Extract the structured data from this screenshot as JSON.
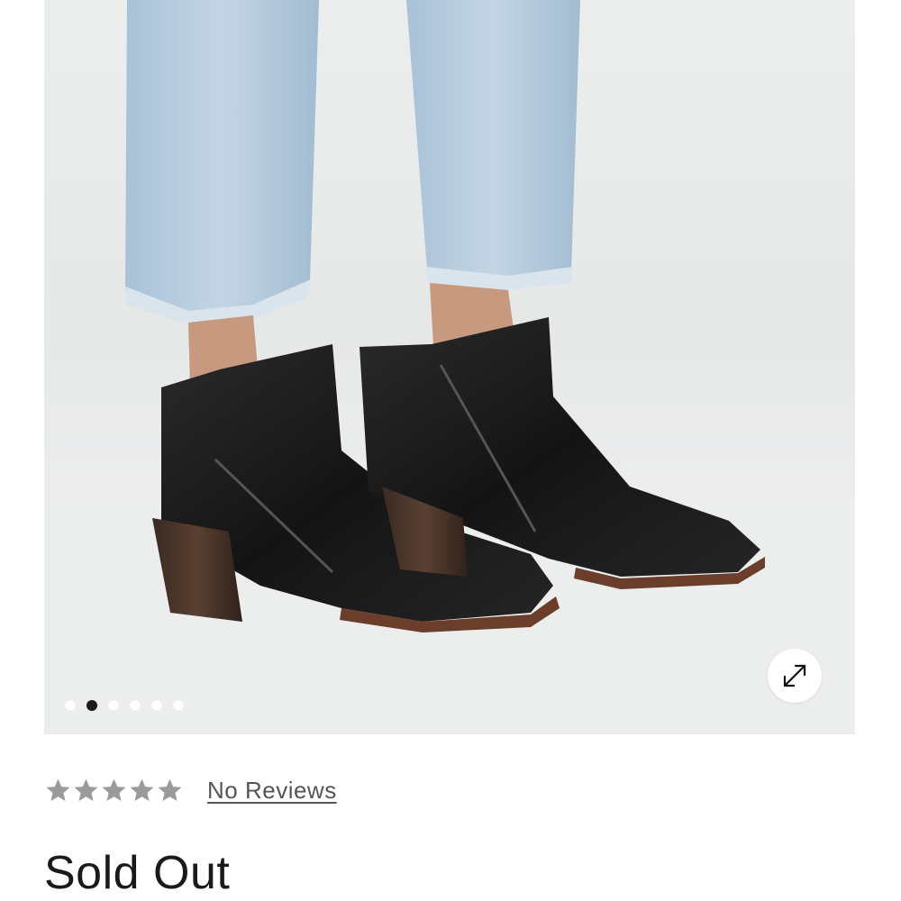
{
  "gallery": {
    "slide_count": 6,
    "active_slide": 2
  },
  "product": {
    "rating_stars": 5,
    "rating_value": 0,
    "reviews_label": "No Reviews",
    "status": "Sold Out"
  },
  "icons": {
    "expand": "expand-arrows-icon",
    "star": "star-icon"
  },
  "colors": {
    "star": "#9a9a9a",
    "active_dot": "#1b1b1b",
    "text": "#1a1a1a"
  }
}
